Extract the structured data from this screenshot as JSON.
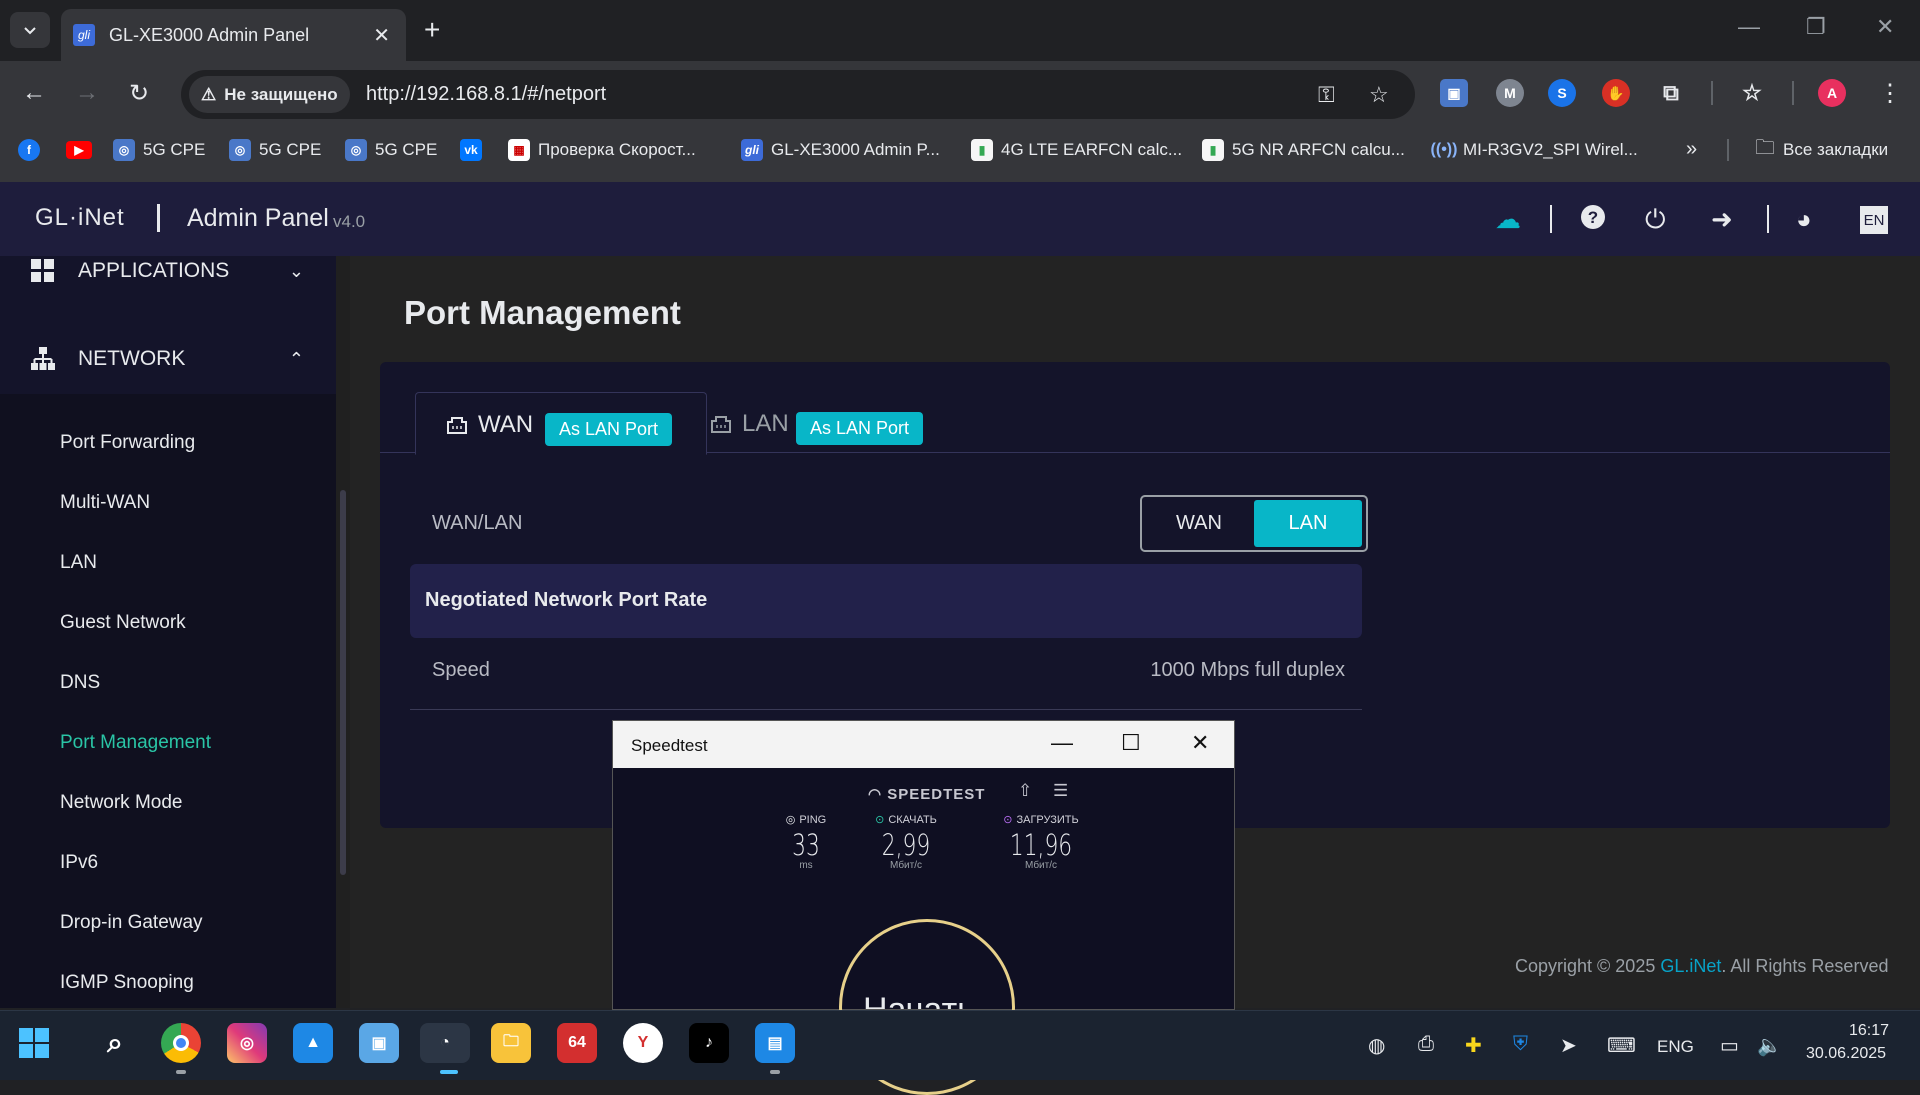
{
  "browser": {
    "tab_title": "GL-XE3000 Admin Panel",
    "new_tab_label": "+",
    "security_label": "Не защищено",
    "url": "http://192.168.8.1/#/netport",
    "profile_initial": "A",
    "bookmarks": [
      {
        "label": "5G CPE",
        "icon": "globe-icon"
      },
      {
        "label": "5G CPE",
        "icon": "globe-icon"
      },
      {
        "label": "5G CPE",
        "icon": "globe-icon"
      },
      {
        "label": "Проверка Скорост...",
        "icon": "speedcheck-icon"
      },
      {
        "label": "GL-XE3000 Admin P...",
        "icon": "glinet-icon"
      },
      {
        "label": "4G LTE EARFCN calc...",
        "icon": "signal-bars-icon"
      },
      {
        "label": "5G NR ARFCN calcu...",
        "icon": "signal-bars-icon"
      },
      {
        "label": "MI-R3GV2_SPI Wirel...",
        "icon": "wireless-icon"
      }
    ],
    "all_bookmarks_label": "Все закладки"
  },
  "app": {
    "logo": "GL·iNet",
    "title": "Admin Panel",
    "version": "v4.0",
    "lang": "EN"
  },
  "sidebar": {
    "groups": [
      {
        "label": "APPLICATIONS",
        "expanded": false
      },
      {
        "label": "NETWORK",
        "expanded": true
      }
    ],
    "network_items": [
      "Port Forwarding",
      "Multi-WAN",
      "LAN",
      "Guest Network",
      "DNS",
      "Port Management",
      "Network Mode",
      "IPv6",
      "Drop-in Gateway",
      "IGMP Snooping"
    ],
    "active_item": "Port Management"
  },
  "main": {
    "page_title": "Port Management",
    "tabs": [
      {
        "label": "WAN",
        "badge": "As LAN Port",
        "active": true
      },
      {
        "label": "LAN",
        "badge": "As LAN Port",
        "active": false
      }
    ],
    "wanlan_label": "WAN/LAN",
    "toggle": {
      "options": [
        "WAN",
        "LAN"
      ],
      "selected": "LAN"
    },
    "rate_section_title": "Negotiated Network Port Rate",
    "speed_label": "Speed",
    "speed_value": "1000 Mbps full duplex",
    "copyright_prefix": "Copyright © 2025 ",
    "copyright_link": "GL.iNet",
    "copyright_suffix": ". All Rights Reserved"
  },
  "speedtest": {
    "window_title": "Speedtest",
    "brand": "SPEEDTEST",
    "ping": {
      "label": "PING",
      "value": "33",
      "unit": "ms"
    },
    "download": {
      "label": "СКАЧАТЬ",
      "value": "2,99",
      "unit": "Мбит/с"
    },
    "upload": {
      "label": "ЗАГРУЗИТЬ",
      "value": "11,96",
      "unit": "Мбит/с"
    },
    "go_label": "Начать"
  },
  "taskbar": {
    "lang": "ENG",
    "time": "16:17",
    "date": "30.06.2025",
    "badge_64": "64"
  },
  "colors": {
    "accent_teal": "#08b6c8",
    "active_green": "#2ac5a6",
    "header_bg": "#1e1d3c",
    "card_bg": "#14142a"
  }
}
